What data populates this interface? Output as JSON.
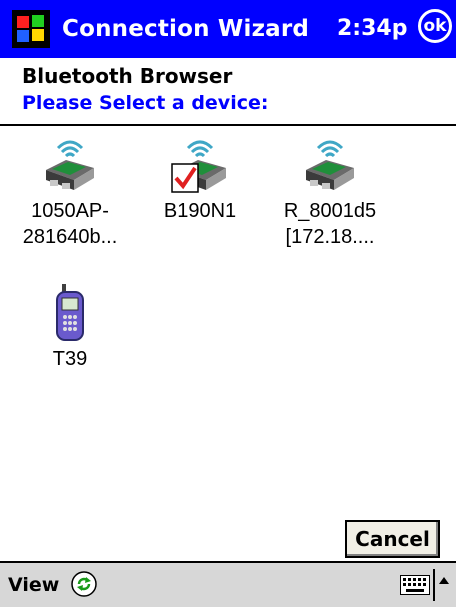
{
  "titlebar": {
    "app_title": "Connection Wizard",
    "clock": "2:34p",
    "ok_label": "ok"
  },
  "header": {
    "title": "Bluetooth Browser",
    "subtitle": "Please Select a device:"
  },
  "devices": [
    {
      "line1": "1050AP-",
      "line2": "281640b...",
      "icon": "access-point-icon"
    },
    {
      "line1": "B190N1",
      "line2": "",
      "icon": "access-point-checked-icon"
    },
    {
      "line1": "R_8001d5",
      "line2": "[172.18....",
      "icon": "access-point-icon"
    },
    {
      "line1": "T39",
      "line2": "",
      "icon": "mobile-phone-icon"
    }
  ],
  "buttons": {
    "cancel": "Cancel"
  },
  "menubar": {
    "view": "View"
  },
  "colors": {
    "titlebar": "#0000ff",
    "subtitle": "#0000ff",
    "menubar": "#d7d7d7"
  }
}
